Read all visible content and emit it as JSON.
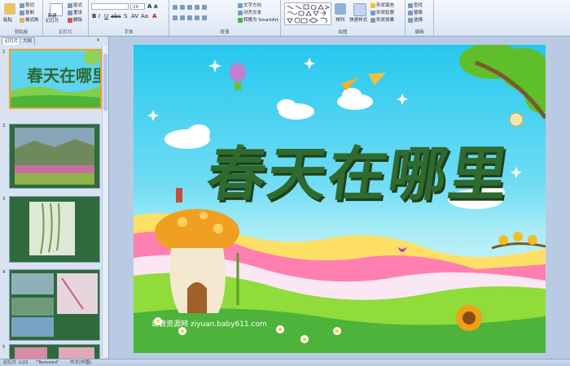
{
  "ribbon": {
    "clipboard": {
      "paste": "粘贴",
      "cut": "剪切",
      "copy": "复制",
      "format_painter": "格式刷",
      "label": "剪贴板"
    },
    "slides": {
      "new_slide": "新建\n幻灯片",
      "layout": "版式",
      "reset": "重设",
      "delete": "删除",
      "label": "幻灯片"
    },
    "font": {
      "size": "24",
      "label": "字体"
    },
    "paragraph": {
      "text_direction": "文字方向",
      "align_text": "对齐文本",
      "smartart": "转换为 SmartArt",
      "label": "段落"
    },
    "drawing": {
      "arrange": "排列",
      "quick_styles": "快速样式",
      "shape_fill": "形状填充",
      "shape_outline": "形状轮廓",
      "shape_effects": "形状效果",
      "label": "绘图"
    },
    "editing": {
      "find": "查找",
      "replace": "替换",
      "select": "选择",
      "label": "编辑"
    }
  },
  "panel": {
    "tabs": [
      "幻灯片",
      "大纲"
    ],
    "slide_numbers": [
      "1",
      "2",
      "3",
      "4",
      "5"
    ]
  },
  "slide": {
    "title": "春天在哪里",
    "watermark": "幼教资源网 ziyuan.baby611.com"
  },
  "status": {
    "slide_info": "幻灯片 1/22",
    "theme": "\"Textured\"",
    "language": "中文(中国)"
  },
  "colors": {
    "title": "#2f6a2e",
    "ribbon": "#dbe6f4",
    "sky": "#26c8ee"
  }
}
